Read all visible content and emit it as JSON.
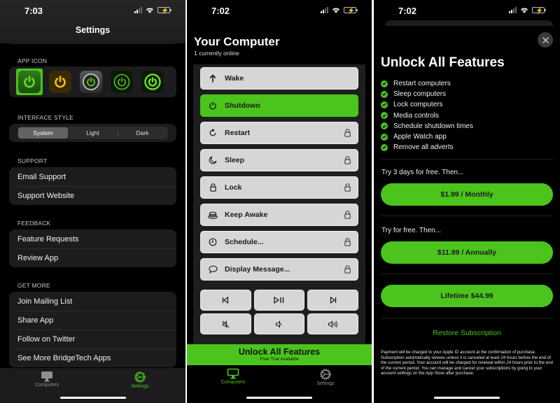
{
  "colors": {
    "accent": "#4bc41c",
    "background": "#000000",
    "grouped": "#1c1c1e",
    "button": "#d6d6d6"
  },
  "settings_screen": {
    "status": {
      "time": "7:03"
    },
    "nav_title": "Settings",
    "app_icon": {
      "label": "APP ICON",
      "icons": [
        {
          "name": "green-classic",
          "selected": true
        },
        {
          "name": "yellow",
          "selected": false
        },
        {
          "name": "metal-ring",
          "selected": false
        },
        {
          "name": "dark-green-ring",
          "selected": false
        },
        {
          "name": "dark-green-bold",
          "selected": false
        }
      ]
    },
    "interface_style": {
      "label": "INTERFACE STYLE",
      "options": [
        "System",
        "Light",
        "Dark"
      ],
      "selected": "System"
    },
    "support": {
      "label": "SUPPORT",
      "items": [
        "Email Support",
        "Support Website"
      ]
    },
    "feedback": {
      "label": "FEEDBACK",
      "items": [
        "Feature Requests",
        "Review App"
      ]
    },
    "get_more": {
      "label": "GET MORE",
      "items": [
        "Join Mailing List",
        "Share App",
        "Follow on Twitter",
        "See More BridgeTech Apps"
      ]
    },
    "tabs": [
      {
        "label": "Computers",
        "icon": "monitor-icon",
        "active": false
      },
      {
        "label": "Settings",
        "icon": "gear-icon",
        "active": true
      }
    ]
  },
  "computer_screen": {
    "status": {
      "time": "7:02"
    },
    "title": "Your Computer",
    "subtitle": "1 currently online",
    "actions": [
      {
        "label": "Wake",
        "icon": "arrow-up-icon",
        "locked": false,
        "highlighted": false
      },
      {
        "label": "Shutdown",
        "icon": "power-icon",
        "locked": false,
        "highlighted": true
      },
      {
        "label": "Restart",
        "icon": "restart-icon",
        "locked": true,
        "highlighted": false
      },
      {
        "label": "Sleep",
        "icon": "moon-icon",
        "locked": true,
        "highlighted": false
      },
      {
        "label": "Lock",
        "icon": "lock-icon",
        "locked": true,
        "highlighted": false
      },
      {
        "label": "Keep Awake",
        "icon": "coffee-cup-icon",
        "locked": true,
        "highlighted": false
      },
      {
        "label": "Schedule...",
        "icon": "clock-icon",
        "locked": true,
        "highlighted": false
      },
      {
        "label": "Display Message...",
        "icon": "speech-bubble-icon",
        "locked": true,
        "highlighted": false
      }
    ],
    "media_controls": [
      "previous-track-icon",
      "play-pause-icon",
      "next-track-icon",
      "mute-icon",
      "volume-down-icon",
      "volume-up-icon"
    ],
    "unlock_banner": {
      "title": "Unlock All Features",
      "subtitle": "Free Trial Available"
    },
    "tabs": [
      {
        "label": "Computers",
        "icon": "monitor-icon",
        "active": true
      },
      {
        "label": "Settings",
        "icon": "gear-icon",
        "active": false
      }
    ]
  },
  "paywall_screen": {
    "status": {
      "time": "7:02"
    },
    "title": "Unlock All Features",
    "features": [
      "Restart computers",
      "Sleep computers",
      "Lock computers",
      "Media controls",
      "Schedule shutdown times",
      "Apple Watch app",
      "Remove all adverts"
    ],
    "offers": [
      {
        "intro": "Try 3 days for free. Then...",
        "button": "$1.99 / Monthly"
      },
      {
        "intro": "Try  for free. Then...",
        "button": "$11.99 / Annually"
      },
      {
        "intro": "",
        "button": "Lifetime $44.99"
      }
    ],
    "restore": "Restore Subscription",
    "legal": "Payment will be charged to your Apple ID account at the confirmation of purchase. Subscription automatically renews unless it is canceled at least 24 hours before the end of the current period. Your account will be charged for renewal within 24 hours prior to the end of the current period. You can manage and cancel your subscriptions by going to your account settings on the App Store after purchase."
  }
}
